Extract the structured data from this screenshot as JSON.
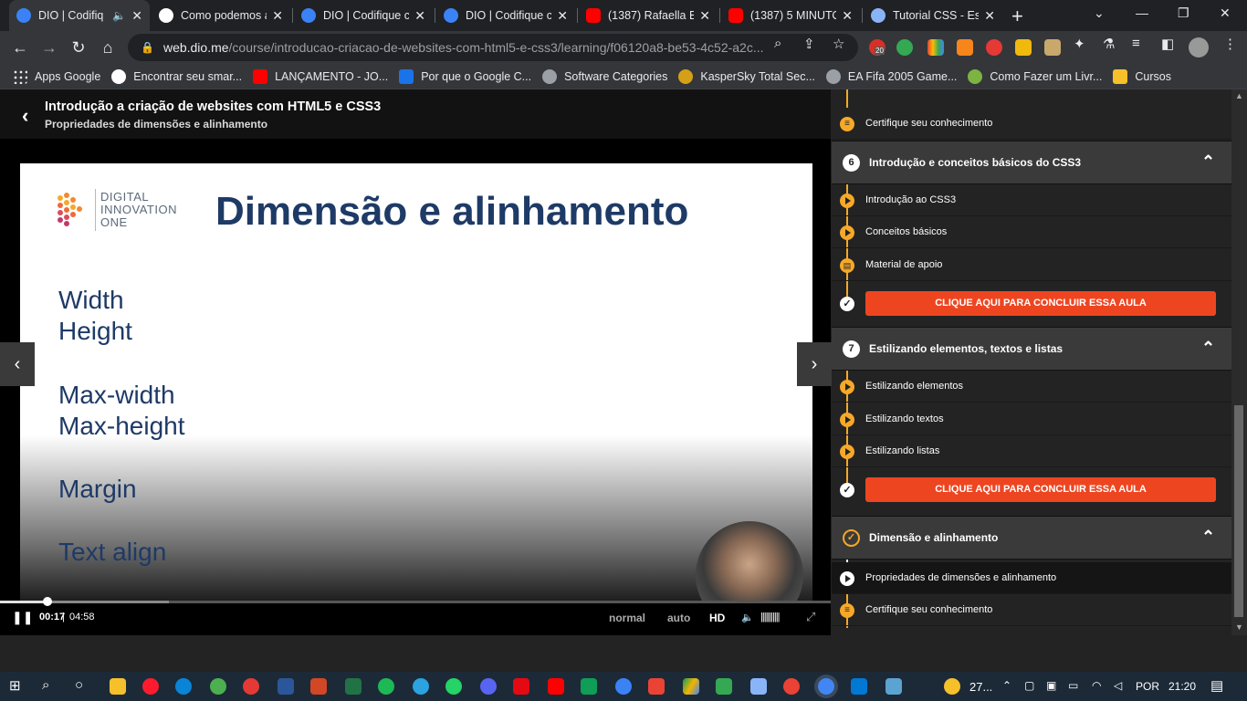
{
  "browser": {
    "tabs": [
      {
        "title": "DIO | Codifiq",
        "favicon_color": "#3b82f6",
        "audio_icon": "🔈",
        "active": true
      },
      {
        "title": "Como podemos a",
        "favicon_color": "#ffffff",
        "active": false
      },
      {
        "title": "DIO | Codifique c",
        "favicon_color": "#3b82f6",
        "active": false
      },
      {
        "title": "DIO | Codifique c",
        "favicon_color": "#3b82f6",
        "active": false
      },
      {
        "title": "(1387) Rafaella B",
        "favicon_color": "#ff0000",
        "active": false
      },
      {
        "title": "(1387) 5 MINUTO",
        "favicon_color": "#ff0000",
        "active": false
      },
      {
        "title": "Tutorial CSS - Est",
        "favicon_color": "#8ab4f8",
        "active": false
      }
    ],
    "tab_close_glyph": "✕",
    "new_tab_glyph": "+",
    "window_controls": {
      "tab_search": "⌄",
      "minimize": "—",
      "restore": "❐",
      "close": "✕"
    },
    "nav": {
      "back": "←",
      "forward": "→",
      "reload": "↻",
      "home": "⌂"
    },
    "url_host": "web.dio.me",
    "url_path": "/course/introducao-criacao-de-websites-com-html5-e-css3/learning/f06120a8-be53-4c52-a2c...",
    "ext_badge": "20",
    "bookmarks": [
      {
        "label": "Apps Google",
        "icon_color": "#5f6368"
      },
      {
        "label": "Encontrar seu smar...",
        "icon_color": "#4285f4"
      },
      {
        "label": "LANÇAMENTO - JO...",
        "icon_color": "#ff0000"
      },
      {
        "label": "Por que o Google C...",
        "icon_color": "#1a73e8"
      },
      {
        "label": "Software Categories",
        "icon_color": "#9aa0a6"
      },
      {
        "label": "KasperSky Total Sec...",
        "icon_color": "#d4a017"
      },
      {
        "label": "EA Fifa 2005 Game...",
        "icon_color": "#9aa0a6"
      },
      {
        "label": "Como Fazer um Livr...",
        "icon_color": "#7cb342"
      },
      {
        "label": "Cursos",
        "icon_color": "#f6c02b"
      }
    ]
  },
  "course": {
    "title": "Introdução a criação de websites com HTML5 e CSS3",
    "subtitle": "Propriedades de dimensões e alinhamento"
  },
  "slide": {
    "logo_text": [
      "DIGITAL",
      "INNOVATION",
      "ONE"
    ],
    "title": "Dimensão e alinhamento",
    "items": [
      "Width",
      "Height",
      "Max-width",
      "Max-height",
      "Margin",
      "Text align"
    ]
  },
  "player": {
    "current_time": "00:17",
    "separator": "|",
    "duration": "04:58",
    "speed": "normal",
    "quality": "auto",
    "hd": "HD",
    "progress_fraction": 0.057,
    "buffer_fraction": 0.203,
    "prev_arrow": "‹",
    "next_arrow": "›"
  },
  "sidebar": {
    "top_lesson": "Certifique seu conhecimento",
    "modules": [
      {
        "number": "6",
        "title": "Introdução e conceitos básicos do CSS3",
        "lessons": [
          "Introdução ao CSS3",
          "Conceitos básicos",
          "Material de apoio"
        ],
        "complete_label": "CLIQUE AQUI PARA CONCLUIR ESSA AULA"
      },
      {
        "number": "7",
        "title": "Estilizando elementos, textos e listas",
        "lessons": [
          "Estilizando elementos",
          "Estilizando textos",
          "Estilizando listas"
        ],
        "complete_label": "CLIQUE AQUI PARA CONCLUIR ESSA AULA"
      },
      {
        "number": "✓",
        "title": "Dimensão e alinhamento",
        "lessons": [
          "Propriedades de dimensões e alinhamento",
          "Certifique seu conhecimento"
        ]
      }
    ],
    "chevron": "⌃"
  },
  "taskbar": {
    "weather": "27...",
    "language": "POR",
    "time": "21:20"
  },
  "colors": {
    "accent_orange": "#f6a828",
    "cta_red": "#ee4521",
    "slide_title_blue": "#1e3a66"
  }
}
